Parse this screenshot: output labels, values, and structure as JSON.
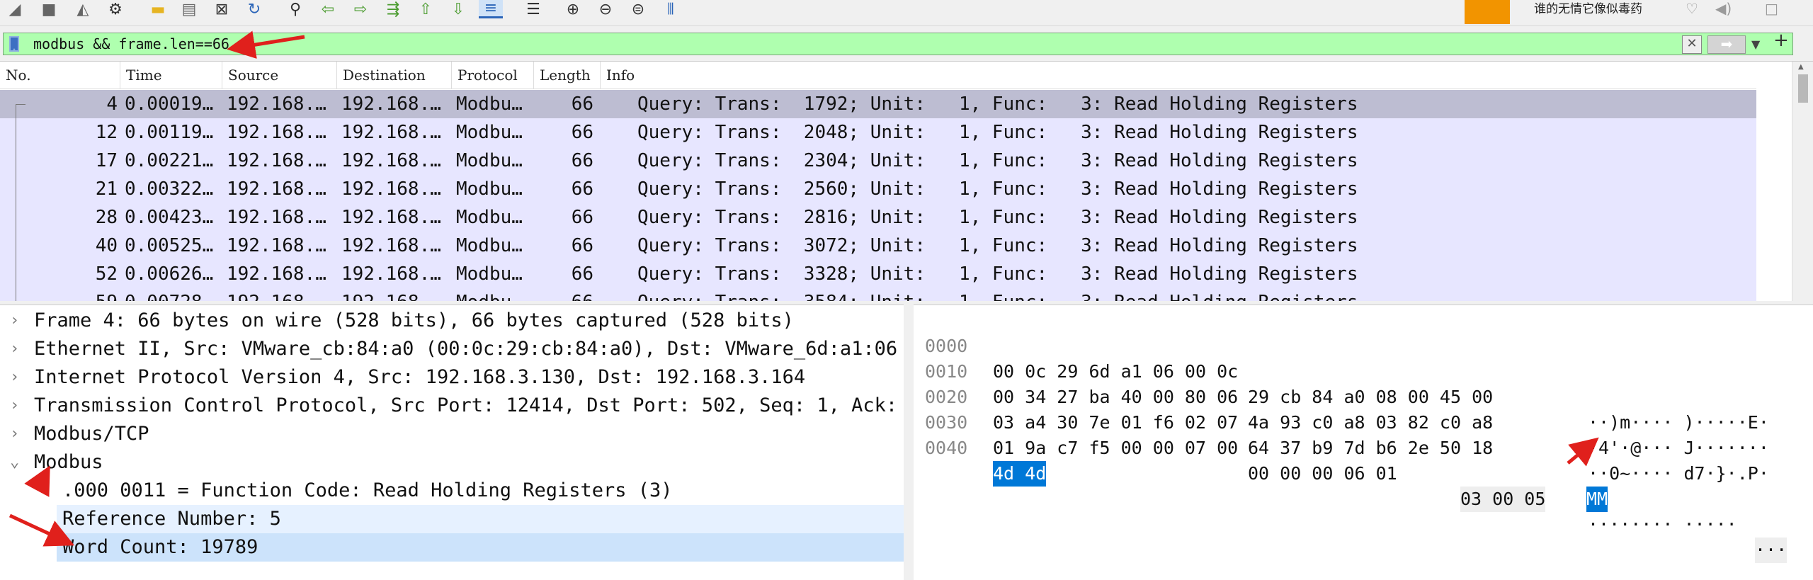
{
  "toolbar": {
    "icons": [
      "shark-fin-start-icon",
      "stop-icon",
      "restart-icon",
      "options-gear-icon",
      "open-folder-icon",
      "save-file-icon",
      "close-file-icon",
      "reload-icon",
      "find-packet-icon",
      "go-back-icon",
      "go-forward-icon",
      "go-to-packet-icon",
      "go-first-icon",
      "go-last-icon",
      "auto-scroll-icon",
      "colorize-icon",
      "zoom-in-icon",
      "zoom-out-icon",
      "normal-size-icon",
      "resize-columns-icon"
    ],
    "ext_text": "谁的无情它像似毒药",
    "brand_color": "#f29400"
  },
  "filter": {
    "value": "modbus && frame.len==66",
    "background": "#afffaf"
  },
  "packet_list": {
    "columns": [
      "No.",
      "Time",
      "Source",
      "Destination",
      "Protocol",
      "Length",
      "Info"
    ],
    "rows": [
      {
        "no": "4",
        "time": "0.00019…",
        "src": "192.168.…",
        "dst": "192.168.…",
        "proto": "Modbu…",
        "len": "66",
        "info": "Query: Trans:  1792; Unit:   1, Func:   3: Read Holding Registers"
      },
      {
        "no": "12",
        "time": "0.00119…",
        "src": "192.168.…",
        "dst": "192.168.…",
        "proto": "Modbu…",
        "len": "66",
        "info": "Query: Trans:  2048; Unit:   1, Func:   3: Read Holding Registers"
      },
      {
        "no": "17",
        "time": "0.00221…",
        "src": "192.168.…",
        "dst": "192.168.…",
        "proto": "Modbu…",
        "len": "66",
        "info": "Query: Trans:  2304; Unit:   1, Func:   3: Read Holding Registers"
      },
      {
        "no": "21",
        "time": "0.00322…",
        "src": "192.168.…",
        "dst": "192.168.…",
        "proto": "Modbu…",
        "len": "66",
        "info": "Query: Trans:  2560; Unit:   1, Func:   3: Read Holding Registers"
      },
      {
        "no": "28",
        "time": "0.00423…",
        "src": "192.168.…",
        "dst": "192.168.…",
        "proto": "Modbu…",
        "len": "66",
        "info": "Query: Trans:  2816; Unit:   1, Func:   3: Read Holding Registers"
      },
      {
        "no": "40",
        "time": "0.00525…",
        "src": "192.168.…",
        "dst": "192.168.…",
        "proto": "Modbu…",
        "len": "66",
        "info": "Query: Trans:  3072; Unit:   1, Func:   3: Read Holding Registers"
      },
      {
        "no": "52",
        "time": "0.00626…",
        "src": "192.168.…",
        "dst": "192.168.…",
        "proto": "Modbu…",
        "len": "66",
        "info": "Query: Trans:  3328; Unit:   1, Func:   3: Read Holding Registers"
      },
      {
        "no": "59",
        "time": "0.00728…",
        "src": "192.168.…",
        "dst": "192.168.…",
        "proto": "Modbu…",
        "len": "66",
        "info": "Query: Trans:  3584; Unit:   1, Func:   3: Read Holding Registers"
      }
    ],
    "row_color": "#e7e6ff",
    "selected_color": "#bdbdd2"
  },
  "details": {
    "items": [
      {
        "text": "Frame 4: 66 bytes on wire (528 bits), 66 bytes captured (528 bits)",
        "expanded": false
      },
      {
        "text": "Ethernet II, Src: VMware_cb:84:a0 (00:0c:29:cb:84:a0), Dst: VMware_6d:a1:06",
        "expanded": false
      },
      {
        "text": "Internet Protocol Version 4, Src: 192.168.3.130, Dst: 192.168.3.164",
        "expanded": false
      },
      {
        "text": "Transmission Control Protocol, Src Port: 12414, Dst Port: 502, Seq: 1, Ack:",
        "expanded": false
      },
      {
        "text": "Modbus/TCP",
        "expanded": false
      },
      {
        "text": "Modbus",
        "expanded": true
      }
    ],
    "children": [
      {
        "text": ".000 0011 = Function Code: Read Holding Registers (3)"
      },
      {
        "text": "Reference Number: 5"
      },
      {
        "text": "Word Count: 19789"
      }
    ],
    "selected_color": "#cce3fb"
  },
  "bytes": {
    "rows": [
      {
        "offset": "0000",
        "hex_a": "00 0c 29 6d a1 06 00 0c",
        "hex_b": "29 cb 84 a0 08 00 45 00",
        "ascii": "··)m···· )·····E·"
      },
      {
        "offset": "0010",
        "hex_a": "00 34 27 ba 40 00 80 06",
        "hex_b": "4a 93 c0 a8 03 82 c0 a8",
        "ascii": "·4'·@··· J·······"
      },
      {
        "offset": "0020",
        "hex_a": "03 a4 30 7e 01 f6 02 07",
        "hex_b": "64 37 b9 7d b6 2e 50 18",
        "ascii": "··0~···· d7·}·.P·"
      },
      {
        "offset": "0030",
        "hex_a": "01 9a c7 f5 00 00 07 00",
        "hex_b": "00 00 00 06 01",
        "hex_c": "03 00 05",
        "ascii": "········ ·····",
        "ascii_b": "···"
      },
      {
        "offset": "0040",
        "hex_sel": "4d 4d",
        "ascii_sel": "MM"
      }
    ],
    "selection_color": "#0078d7"
  },
  "annotation_color": "#e0201c"
}
